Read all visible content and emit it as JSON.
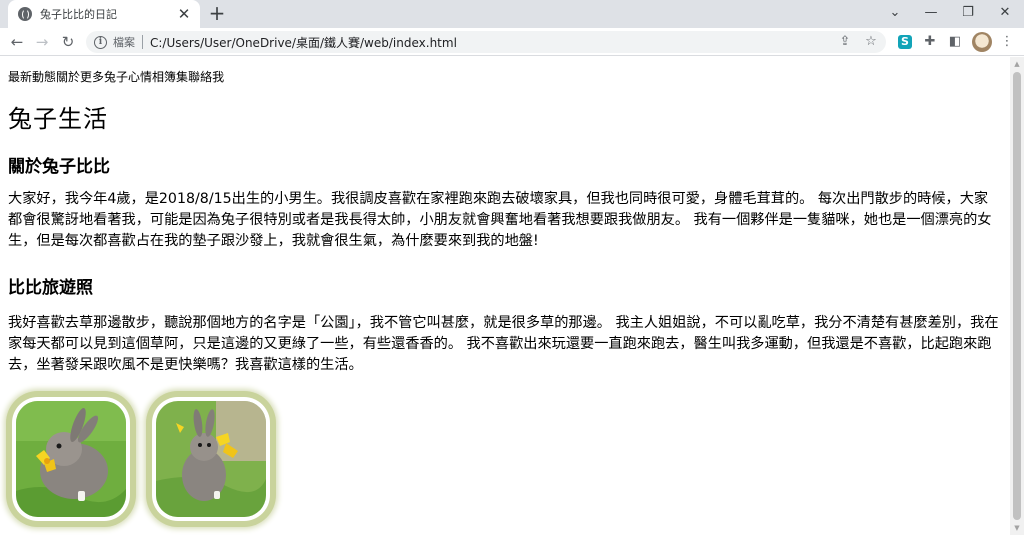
{
  "browser": {
    "tab_title": "兔子比比的日記",
    "tab_close": "✕",
    "new_tab": "+",
    "window_controls": {
      "tab_search": "⌄",
      "minimize": "—",
      "restore": "❐",
      "close": "✕"
    },
    "nav": {
      "back": "←",
      "forward": "→",
      "reload": "↻"
    },
    "address": {
      "scheme_label": "檔案",
      "url": "C:/Users/User/OneDrive/桌面/鐵人賽/web/index.html"
    },
    "icons": [
      "share-icon",
      "star-icon",
      "extension-s-icon",
      "puzzle-icon",
      "sidepanel-icon",
      "profile-avatar",
      "menu-icon"
    ],
    "extension_letter": "S"
  },
  "page": {
    "nav_links": [
      "最新動態",
      "關於",
      "更多兔子心情",
      "相簿集",
      "聯絡我"
    ],
    "heading": "兔子生活",
    "sections": [
      {
        "title": "關於兔子比比",
        "paragraph": "大家好，我今年4歲，是2018/8/15出生的小男生。我很調皮喜歡在家裡跑來跑去破壞家具，但我也同時很可愛，身體毛茸茸的。 每次出門散步的時候，大家都會很驚訝地看著我，可能是因為兔子很特別或者是我長得太帥，小朋友就會興奮地看著我想要跟我做朋友。 我有一個夥伴是一隻貓咪，她也是一個漂亮的女生，但是每次都喜歡占在我的墊子跟沙發上，我就會很生氣，為什麼要來到我的地盤!"
      },
      {
        "title": "比比旅遊照",
        "paragraph": "我好喜歡去草那邊散步，聽說那個地方的名字是「公園」，我不管它叫甚麼，就是很多草的那邊。 我主人姐姐說，不可以亂吃草，我分不清楚有甚麼差別，我在家每天都可以見到這個草阿，只是這邊的又更綠了一些，有些還香香的。 我不喜歡出來玩還要一直跑來跑去，醫生叫我多運動，但我還是不喜歡，比起跑來跑去，坐著發呆跟吹風不是更快樂嗎？我喜歡這樣的生活。"
      }
    ],
    "photos": [
      "rabbit-photo-1",
      "rabbit-photo-2"
    ]
  },
  "colors": {
    "tabstrip": "#dee1e6",
    "photo_frame": "#c9d39c",
    "grass": "#6fae3f",
    "rabbit_fur": "#8a8580",
    "flower": "#f5d523"
  }
}
